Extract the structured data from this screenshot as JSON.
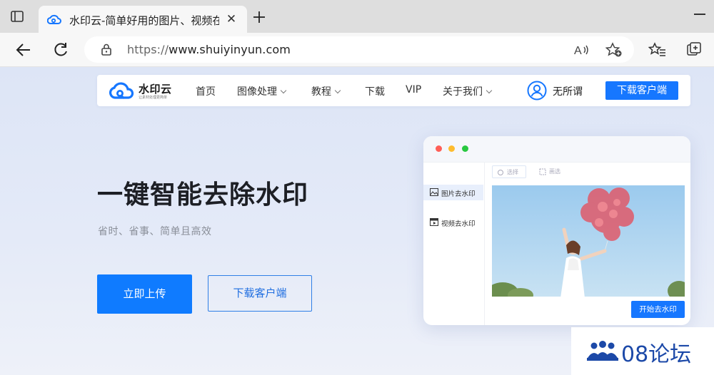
{
  "browser": {
    "tab": {
      "title": "水印云-简单好用的图片、视频在",
      "close_label": "✕"
    },
    "address": {
      "scheme": "https://",
      "host": "www.shuiyinyun.com"
    }
  },
  "site": {
    "logo": {
      "name": "水印云",
      "tagline": "让素材处理更简单"
    },
    "nav": [
      {
        "label": "首页",
        "has_caret": false
      },
      {
        "label": "图像处理",
        "has_caret": true
      },
      {
        "label": "教程",
        "has_caret": true
      },
      {
        "label": "下载",
        "has_caret": false
      },
      {
        "label": "VIP",
        "has_caret": false
      },
      {
        "label": "关于我们",
        "has_caret": true
      }
    ],
    "user_name": "无所谓",
    "header_download": "下载客户端"
  },
  "hero": {
    "title": "一键智能去除水印",
    "subtitle": "省时、省事、简单且高效",
    "upload_label": "立即上传",
    "download_label": "下载客户端"
  },
  "demo": {
    "sidebar": [
      {
        "label": "图片去水印",
        "active": true
      },
      {
        "label": "视频去水印",
        "active": false
      }
    ],
    "tools": {
      "select": "选择",
      "brush": "画选"
    },
    "start_label": "开始去水印"
  },
  "watermark": {
    "text": "08论坛"
  },
  "colors": {
    "brand": "#1677ff",
    "accent_blue": "#0f7bff",
    "watermark_blue": "#1c49a8"
  }
}
